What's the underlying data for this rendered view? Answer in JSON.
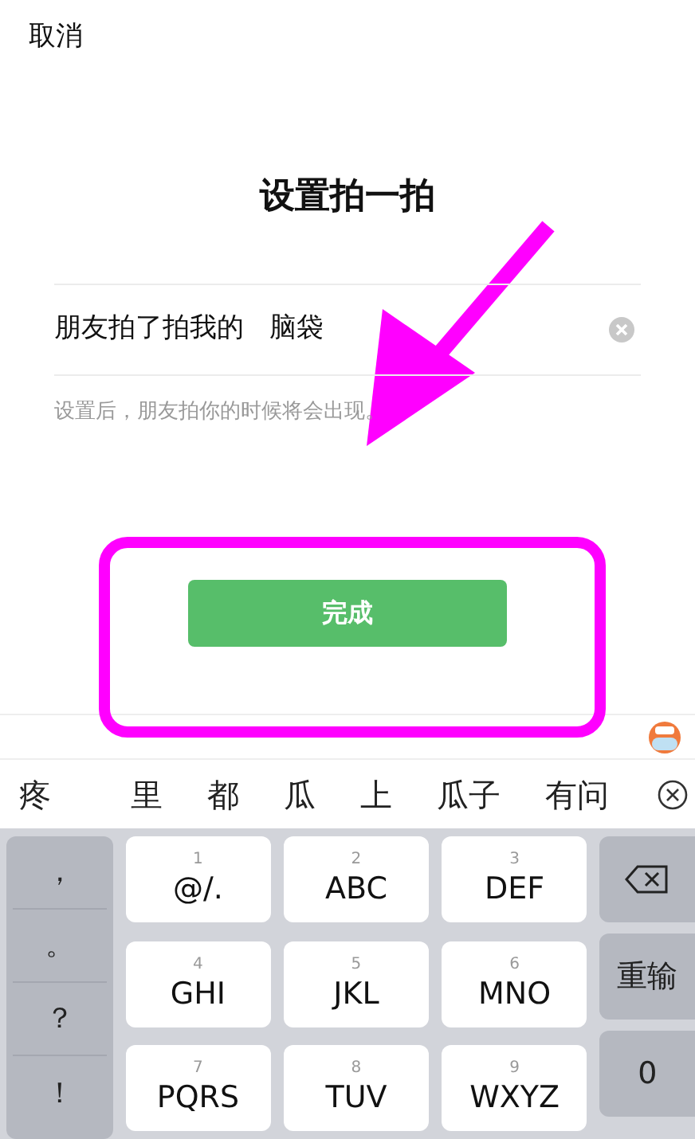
{
  "header": {
    "cancel": "取消"
  },
  "title": "设置拍一拍",
  "field": {
    "prefix": "朋友拍了拍我的",
    "value": "脑袋"
  },
  "hint": "设置后，朋友拍你的时候将会出现。",
  "done_button": "完成",
  "keyboard": {
    "candidates": [
      "疼",
      "里",
      "都",
      "瓜",
      "上",
      "瓜子",
      "有问"
    ],
    "punctuation": [
      "，",
      "。",
      "？",
      "！"
    ],
    "keys": [
      {
        "digit": "1",
        "letters": "@/."
      },
      {
        "digit": "2",
        "letters": "ABC"
      },
      {
        "digit": "3",
        "letters": "DEF"
      },
      {
        "digit": "4",
        "letters": "GHI"
      },
      {
        "digit": "5",
        "letters": "JKL"
      },
      {
        "digit": "6",
        "letters": "MNO"
      },
      {
        "digit": "7",
        "letters": "PQRS"
      },
      {
        "digit": "8",
        "letters": "TUV"
      },
      {
        "digit": "9",
        "letters": "WXYZ"
      }
    ],
    "side": [
      {
        "kind": "backspace"
      },
      {
        "kind": "text",
        "label": "重输"
      },
      {
        "kind": "text",
        "label": "0"
      }
    ]
  }
}
